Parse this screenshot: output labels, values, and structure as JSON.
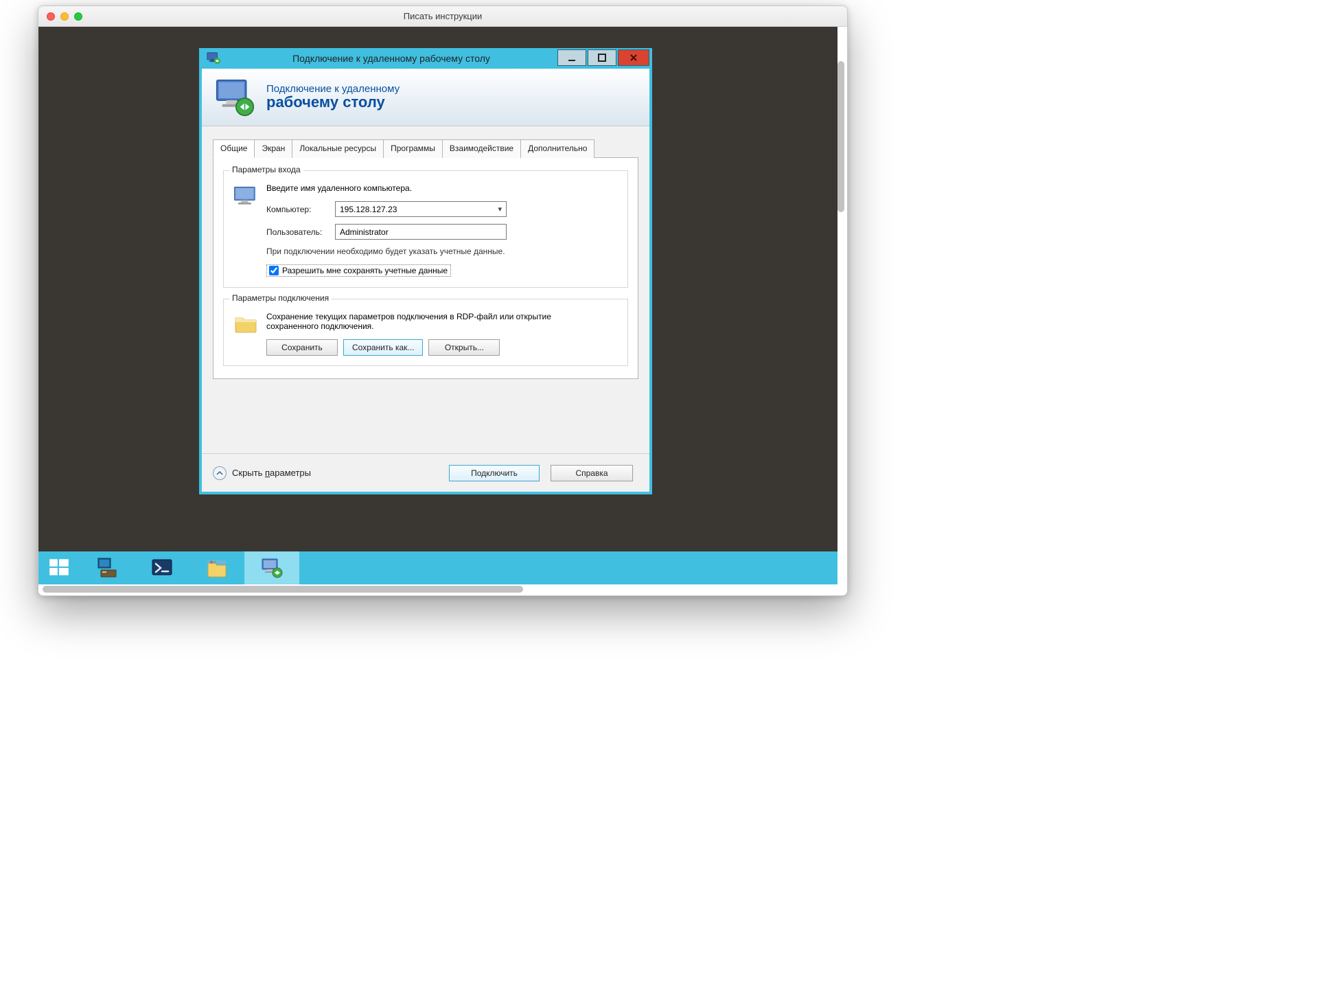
{
  "mac": {
    "title": "Писать инструкции"
  },
  "rdp": {
    "window_title": "Подключение к удаленному рабочему столу",
    "header_line1": "Подключение к удаленному",
    "header_line2": "рабочему столу",
    "tabs": {
      "general": "Общие",
      "display": "Экран",
      "local": "Локальные ресурсы",
      "programs": "Программы",
      "experience": "Взаимодействие",
      "advanced": "Дополнительно"
    },
    "login_group": {
      "title": "Параметры входа",
      "instruction": "Введите имя удаленного компьютера.",
      "computer_label": "Компьютер:",
      "computer_value": "195.128.127.23",
      "user_label": "Пользователь:",
      "user_value": "Administrator",
      "hint": "При подключении необходимо будет указать учетные данные.",
      "save_creds_label": "Разрешить мне сохранять учетные данные"
    },
    "conn_group": {
      "title": "Параметры подключения",
      "instruction": "Сохранение текущих параметров подключения в RDP-файл или открытие сохраненного подключения.",
      "save": "Сохранить",
      "save_as": "Сохранить как...",
      "open": "Открыть..."
    },
    "footer": {
      "toggle_pre": "Скрыть ",
      "toggle_accel": "п",
      "toggle_post": "араметры",
      "connect": "Подключить",
      "help": "Справка"
    }
  }
}
